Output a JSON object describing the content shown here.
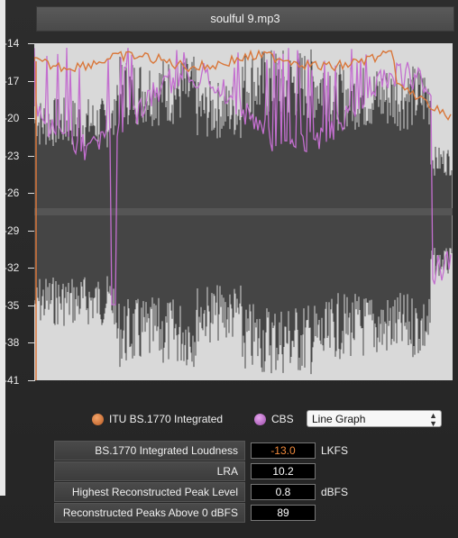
{
  "window": {
    "title": "soulful 9.mp3"
  },
  "y_axis": {
    "ticks": [
      "-14",
      "-17",
      "-20",
      "-23",
      "-26",
      "-29",
      "-32",
      "-35",
      "-38",
      "-41"
    ]
  },
  "legend": {
    "integrated_label": "ITU BS.1770 Integrated",
    "integrated_color": "#d9773a",
    "cbs_label": "CBS",
    "cbs_color": "#c36fcf"
  },
  "graph_mode": {
    "selected": "Line Graph"
  },
  "stats": [
    {
      "label": "BS.1770 Integrated Loudness",
      "value": "-13.0",
      "unit": "LKFS"
    },
    {
      "label": "LRA",
      "value": "10.2",
      "unit": ""
    },
    {
      "label": "Highest Reconstructed Peak Level",
      "value": "0.8",
      "unit": "dBFS"
    },
    {
      "label": "Reconstructed Peaks Above 0 dBFS",
      "value": "89",
      "unit": ""
    }
  ],
  "chart_data": {
    "type": "line",
    "ylim": [
      -41,
      -14
    ],
    "yticks": [
      -14,
      -17,
      -20,
      -23,
      -26,
      -29,
      -32,
      -35,
      -38,
      -41
    ],
    "series": [
      {
        "name": "ITU BS.1770 Integrated",
        "color": "#d9773a"
      },
      {
        "name": "CBS",
        "color": "#c36fcf"
      }
    ]
  }
}
